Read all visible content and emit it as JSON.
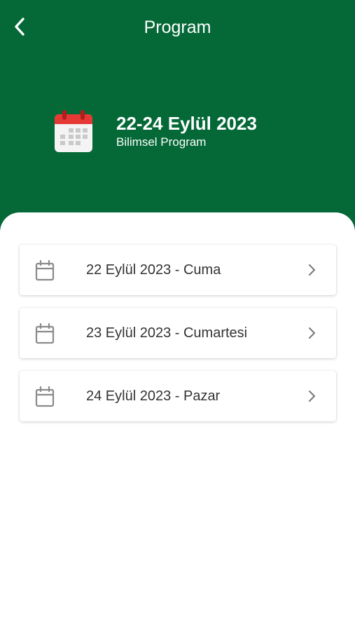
{
  "header": {
    "title": "Program",
    "back_icon": "chevron-left-icon",
    "background_color": "#046837"
  },
  "hero": {
    "icon": "calendar-icon",
    "date": "22-24 Eylül 2023",
    "subtitle": "Bilimsel Program"
  },
  "days": [
    {
      "label": "22 Eylül 2023 - Cuma",
      "icon": "calendar-outline-icon",
      "trailing_icon": "chevron-right-icon"
    },
    {
      "label": "23 Eylül 2023 - Cumartesi",
      "icon": "calendar-outline-icon",
      "trailing_icon": "chevron-right-icon"
    },
    {
      "label": "24 Eylül 2023 - Pazar",
      "icon": "calendar-outline-icon",
      "trailing_icon": "chevron-right-icon"
    }
  ]
}
